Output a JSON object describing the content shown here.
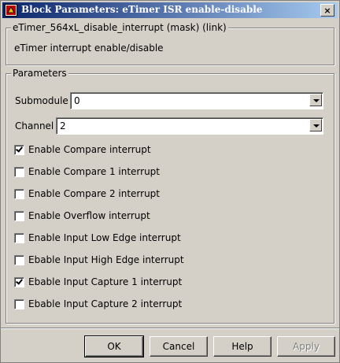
{
  "window": {
    "title": "Block Parameters: eTimer ISR enable-disable",
    "close_label": "×"
  },
  "mask": {
    "legend": "eTimer_564xL_disable_interrupt (mask) (link)",
    "description": "eTimer interrupt enable/disable"
  },
  "parameters": {
    "legend": "Parameters",
    "submodule": {
      "label": "Submodule",
      "value": "0"
    },
    "channel": {
      "label": "Channel",
      "value": "2"
    },
    "checkboxes": [
      {
        "label": "Enable Compare interrupt",
        "checked": true
      },
      {
        "label": "Enable Compare 1 interrupt",
        "checked": false
      },
      {
        "label": "Enable Compare 2 interrupt",
        "checked": false
      },
      {
        "label": "Enable Overflow interrupt",
        "checked": false
      },
      {
        "label": "Enable Input Low Edge interrupt",
        "checked": false
      },
      {
        "label": "Ebable Input High Edge interrupt",
        "checked": false
      },
      {
        "label": "Ebable Input Capture 1 interrupt",
        "checked": true
      },
      {
        "label": "Ebable Input Capture 2 interrupt",
        "checked": false
      }
    ]
  },
  "buttons": {
    "ok": "OK",
    "cancel": "Cancel",
    "help": "Help",
    "apply": "Apply"
  }
}
